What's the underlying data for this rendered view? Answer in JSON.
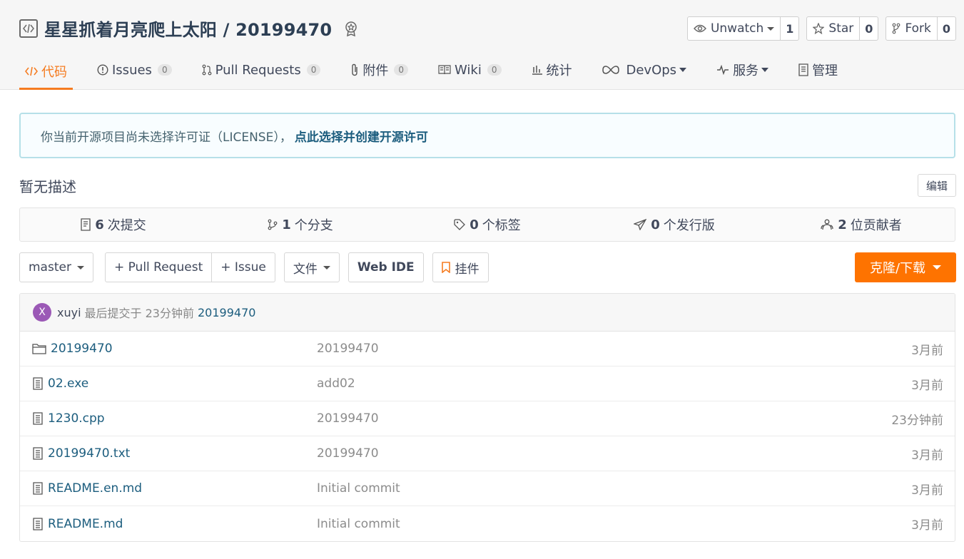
{
  "repo": {
    "owner": "星星抓着月亮爬上太阳",
    "separator": "/",
    "name": "20199470"
  },
  "actions": {
    "watch": {
      "label": "Unwatch",
      "count": "1"
    },
    "star": {
      "label": "Star",
      "count": "0"
    },
    "fork": {
      "label": "Fork",
      "count": "0"
    }
  },
  "tabs": [
    {
      "label": "代码",
      "count": null,
      "active": true
    },
    {
      "label": "Issues",
      "count": "0"
    },
    {
      "label": "Pull Requests",
      "count": "0"
    },
    {
      "label": "附件",
      "count": "0"
    },
    {
      "label": "Wiki",
      "count": "0"
    },
    {
      "label": "统计"
    },
    {
      "label": "DevOps"
    },
    {
      "label": "服务"
    },
    {
      "label": "管理"
    }
  ],
  "notice": {
    "text": "你当前开源项目尚未选择许可证（LICENSE），",
    "link": "点此选择并创建开源许可"
  },
  "description": "暂无描述",
  "edit_label": "编辑",
  "stats": [
    {
      "count": "6",
      "label": "次提交"
    },
    {
      "count": "1",
      "label": "个分支"
    },
    {
      "count": "0",
      "label": "个标签"
    },
    {
      "count": "0",
      "label": "个发行版"
    },
    {
      "count": "2",
      "label": "位贡献者"
    }
  ],
  "toolbar": {
    "branch": "master",
    "pull_request": "+ Pull Request",
    "issue": "+ Issue",
    "file": "文件",
    "webide": "Web IDE",
    "widget": "挂件",
    "clone": "克隆/下载"
  },
  "last_commit": {
    "avatar_letter": "X",
    "author": "xuyi",
    "text": "最后提交于 23分钟前",
    "message": "20199470"
  },
  "files": [
    {
      "type": "folder",
      "name": "20199470",
      "message": "20199470",
      "time": "3月前"
    },
    {
      "type": "file",
      "name": "02.exe",
      "message": "add02",
      "time": "3月前"
    },
    {
      "type": "file",
      "name": "1230.cpp",
      "message": "20199470",
      "time": "23分钟前"
    },
    {
      "type": "file",
      "name": "20199470.txt",
      "message": "20199470",
      "time": "3月前"
    },
    {
      "type": "file",
      "name": "README.en.md",
      "message": "Initial commit",
      "time": "3月前"
    },
    {
      "type": "file",
      "name": "README.md",
      "message": "Initial commit",
      "time": "3月前"
    }
  ],
  "colors": {
    "accent": "#f57c21",
    "clone_button": "#fe7300",
    "link": "#1c5d7e",
    "avatar": "#9b59b6"
  }
}
